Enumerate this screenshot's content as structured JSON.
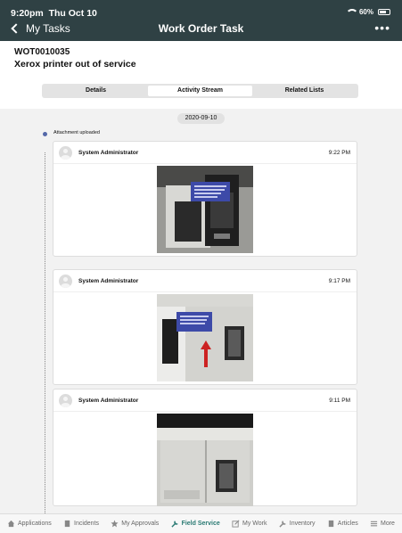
{
  "status_bar": {
    "time": "9:20pm",
    "date": "Thu Oct 10",
    "battery": "60%"
  },
  "nav": {
    "back_label": "My Tasks",
    "title": "Work Order Task",
    "more_label": "•••"
  },
  "record": {
    "number": "WOT0010035",
    "short_description": "Xerox printer out of service"
  },
  "segments": [
    {
      "label": "Details",
      "active": false
    },
    {
      "label": "Activity Stream",
      "active": true
    },
    {
      "label": "Related Lists",
      "active": false
    }
  ],
  "activity": {
    "date": "2020-09-10",
    "event_label": "Attachment uploaded",
    "entries": [
      {
        "author": "System Administrator",
        "time": "9:22 PM",
        "image": "printer-open-drawer-photo"
      },
      {
        "author": "System Administrator",
        "time": "9:17 PM",
        "image": "printer-front-door-photo"
      },
      {
        "author": "System Administrator",
        "time": "9:11 PM",
        "image": "printer-closed-photo"
      }
    ]
  },
  "tabs": [
    {
      "label": "Applications",
      "icon": "home-icon",
      "active": false
    },
    {
      "label": "Incidents",
      "icon": "document-icon",
      "active": false
    },
    {
      "label": "My Approvals",
      "icon": "star-icon",
      "active": false
    },
    {
      "label": "Field Service",
      "icon": "wrench-icon",
      "active": true
    },
    {
      "label": "My Work",
      "icon": "edit-icon",
      "active": false
    },
    {
      "label": "Inventory",
      "icon": "wrench-icon",
      "active": false
    },
    {
      "label": "Articles",
      "icon": "document-icon",
      "active": false
    },
    {
      "label": "More",
      "icon": "menu-icon",
      "active": false
    }
  ],
  "colors": {
    "header_bg": "#2f4144",
    "accent": "#2a7a73",
    "timeline_dot": "#5468a8"
  }
}
